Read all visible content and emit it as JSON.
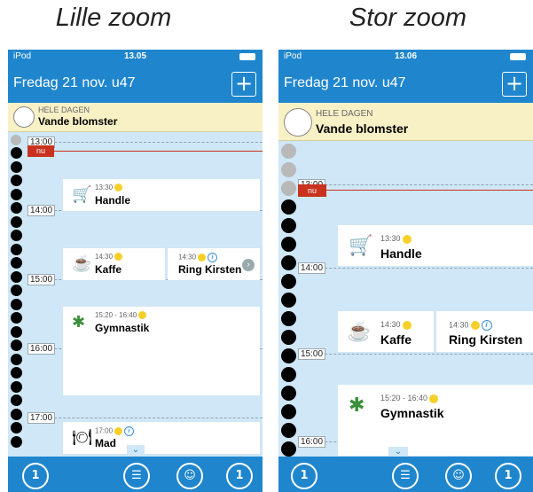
{
  "captions": {
    "left": "Lille zoom",
    "right": "Stor zoom"
  },
  "left": {
    "status": {
      "carrier": "iPod",
      "time": "13.05"
    },
    "nav": {
      "title": "Fredag 21 nov. u47",
      "add": "+"
    },
    "allday": {
      "label": "HELE DAGEN",
      "title": "Vande blomster"
    },
    "hours": [
      "13:00",
      "14:00",
      "15:00",
      "16:00",
      "17:00"
    ],
    "now": "nu",
    "events": [
      {
        "time": "13:30",
        "name": "Handle"
      },
      {
        "time": "14:30",
        "name": "Kaffe"
      },
      {
        "time": "14:30",
        "name": "Ring Kirsten"
      },
      {
        "time": "15:20 - 16:40",
        "name": "Gymnastik"
      },
      {
        "time": "17:00",
        "name": "Mad"
      }
    ]
  },
  "right": {
    "status": {
      "carrier": "iPod",
      "time": "13.06"
    },
    "nav": {
      "title": "Fredag 21 nov. u47",
      "add": "+"
    },
    "allday": {
      "label": "HELE DAGEN",
      "title": "Vande blomster"
    },
    "hours": [
      "13:00",
      "14:00",
      "15:00",
      "16:00"
    ],
    "now": "nu",
    "events": [
      {
        "time": "13:30",
        "name": "Handle"
      },
      {
        "time": "14:30",
        "name": "Kaffe"
      },
      {
        "time": "14:30",
        "name": "Ring Kirsten"
      },
      {
        "time": "15:20 - 16:40",
        "name": "Gymnastik"
      }
    ]
  },
  "tabbar": {
    "week_glyph": "1",
    "info_glyph": "i"
  },
  "colors": {
    "primary": "#1f86ce",
    "allday_bg": "#f8f1c6",
    "now": "#c8321e",
    "bg": "#cfe7f6"
  }
}
